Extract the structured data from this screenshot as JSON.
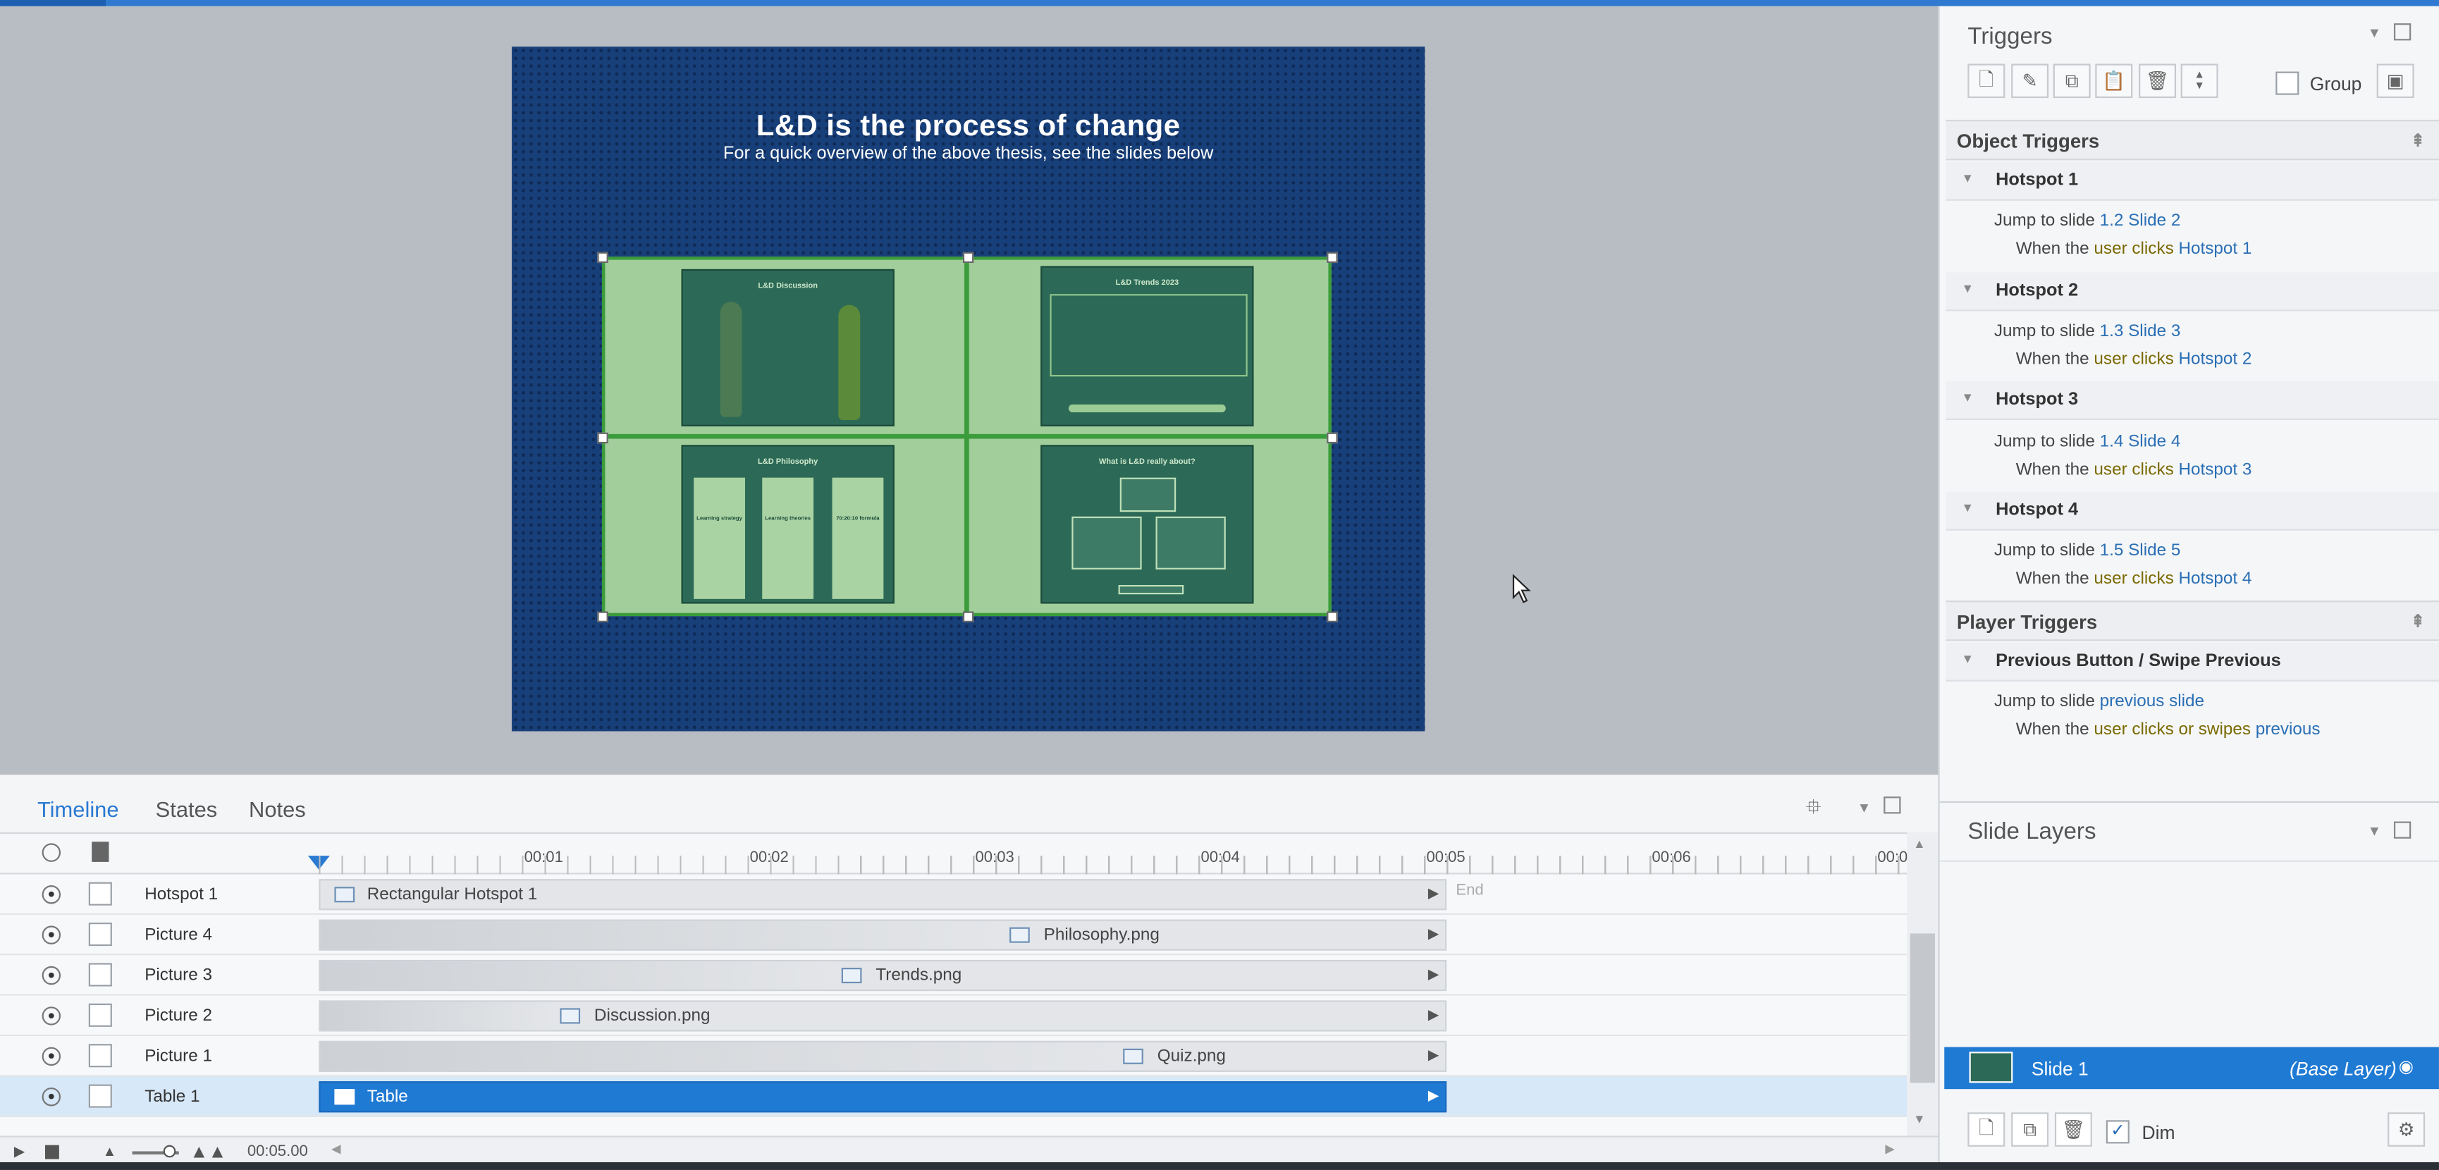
{
  "slide": {
    "title": "L&D is the process of change",
    "subtitle": "For a quick overview of the above thesis, see the slides below",
    "thumbs": {
      "discussion": "L&D Discussion",
      "trends": "L&D Trends 2023",
      "philosophy": "L&D Philosophy",
      "quiz": "What is L&D really about?",
      "cols": [
        "Learning strategy",
        "Learning theories",
        "70:20:10 formula"
      ]
    }
  },
  "triggers": {
    "title": "Triggers",
    "group_label": "Group",
    "object_section": "Object Triggers",
    "player_section": "Player Triggers",
    "items": [
      {
        "name": "Hotspot 1",
        "action": "Jump to slide",
        "target": "1.2 Slide 2",
        "when": "When the",
        "who": "user clicks",
        "obj": "Hotspot 1"
      },
      {
        "name": "Hotspot 2",
        "action": "Jump to slide",
        "target": "1.3 Slide 3",
        "when": "When the",
        "who": "user clicks",
        "obj": "Hotspot 2"
      },
      {
        "name": "Hotspot 3",
        "action": "Jump to slide",
        "target": "1.4 Slide 4",
        "when": "When the",
        "who": "user clicks",
        "obj": "Hotspot 3"
      },
      {
        "name": "Hotspot 4",
        "action": "Jump to slide",
        "target": "1.5 Slide 5",
        "when": "When the",
        "who": "user clicks",
        "obj": "Hotspot 4"
      }
    ],
    "player": {
      "name": "Previous Button / Swipe Previous",
      "action": "Jump to slide",
      "target": "previous slide",
      "when": "When the",
      "who": "user clicks or swipes",
      "obj": "previous"
    }
  },
  "layers": {
    "title": "Slide Layers",
    "slide_name": "Slide 1",
    "base_label": "(Base Layer)",
    "dim_label": "Dim"
  },
  "timeline": {
    "tabs": [
      "Timeline",
      "States",
      "Notes"
    ],
    "ticks": [
      "00:01",
      "00:02",
      "00:03",
      "00:04",
      "00:05",
      "00:06",
      "00:0"
    ],
    "end_label": "End",
    "duration": "00:05.00",
    "rows": [
      {
        "name": "Hotspot 1",
        "bar": "Rectangular Hotspot 1"
      },
      {
        "name": "Picture 4",
        "bar": "Philosophy.png"
      },
      {
        "name": "Picture 3",
        "bar": "Trends.png"
      },
      {
        "name": "Picture 2",
        "bar": "Discussion.png"
      },
      {
        "name": "Picture 1",
        "bar": "Quiz.png"
      },
      {
        "name": "Table 1",
        "bar": "Table"
      }
    ]
  },
  "colors": {
    "accent": "#1f7ad3",
    "slide_bg": "#173f7a",
    "table_fill": "#a1ce9a"
  }
}
